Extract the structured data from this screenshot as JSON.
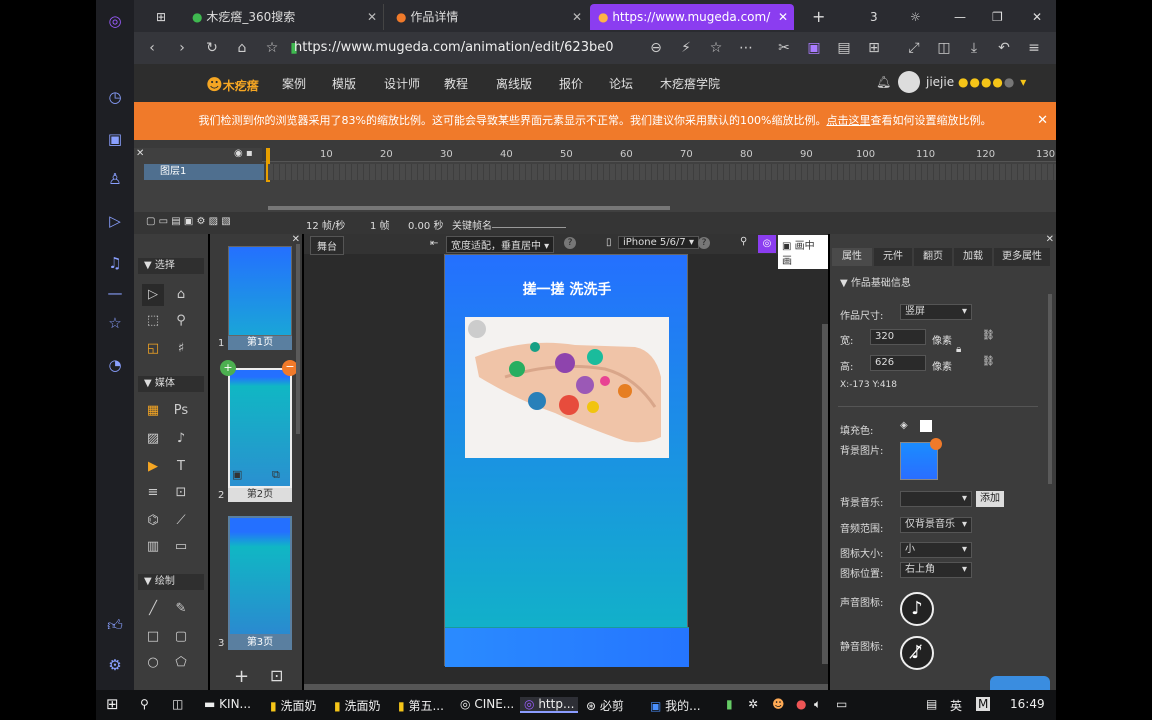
{
  "browser": {
    "tabs": [
      {
        "label": "木疙瘩_360搜索"
      },
      {
        "label": "作品详情"
      },
      {
        "label": "https://www.mugeda.com/"
      }
    ],
    "url": "https://www.mugeda.com/animation/edit/623be0",
    "tab_count": "3"
  },
  "site_nav": {
    "logo": "木疙瘩",
    "items": [
      "案例",
      "模版",
      "设计师",
      "教程",
      "离线版",
      "报价",
      "论坛",
      "木疙瘩学院"
    ],
    "user": "jiejie"
  },
  "warning": {
    "text_before": "我们检测到你的浏览器采用了83%的缩放比例。这可能会导致某些界面元素显示不正常。我们建议你采用默认的100%缩放比例。",
    "link": "点击这里",
    "text_after": "查看如何设置缩放比例。"
  },
  "timeline": {
    "ticks": [
      "10",
      "20",
      "30",
      "40",
      "50",
      "60",
      "70",
      "80",
      "90",
      "100",
      "110",
      "120",
      "130"
    ],
    "layer": "图层1",
    "fps": "12 帧/秒",
    "frame": "1 帧",
    "time": "0.00 秒",
    "keyframe_label": "关键帧名"
  },
  "tools": {
    "section_select": "选择",
    "section_media": "媒体",
    "section_draw": "绘制"
  },
  "pages": [
    {
      "num": "1",
      "label": "第1页"
    },
    {
      "num": "2",
      "label": "第2页"
    },
    {
      "num": "3",
      "label": "第3页"
    }
  ],
  "stage": {
    "tab": "舞台",
    "fit": "宽度适配，垂直居中",
    "device": "iPhone 5/6/7",
    "picture_in_picture": "画中画",
    "title": "搓一搓 洗洗手"
  },
  "props": {
    "tabs": [
      "属性",
      "元件",
      "翻页",
      "加载",
      "更多属性"
    ],
    "section": "作品基础信息",
    "size_label": "作品尺寸:",
    "size_value": "竖屏",
    "width_label": "宽:",
    "width_value": "320",
    "height_label": "高:",
    "height_value": "626",
    "unit": "像素",
    "coords": "X:-173  Y:418",
    "fill_label": "填充色:",
    "bgimg_label": "背景图片:",
    "bgmusic_label": "背景音乐:",
    "add_button": "添加",
    "sound_range_label": "音频范围:",
    "sound_range_value": "仅背景音乐",
    "icon_size_label": "图标大小:",
    "icon_size_value": "小",
    "icon_pos_label": "图标位置:",
    "icon_pos_value": "右上角",
    "sound_icon_label": "声音图标:",
    "mute_icon_label": "静音图标:"
  },
  "taskbar": {
    "items": [
      "KIN...",
      "洗面奶",
      "洗面奶",
      "第五...",
      "CINE...",
      "http...",
      "必剪",
      "我的..."
    ],
    "ime": "英",
    "time": "16:49"
  },
  "colors": {
    "accent": "#8b3df0",
    "warning": "#f07a2a",
    "stage_top": "#2470ff",
    "stage_bottom": "#10b7c4"
  }
}
